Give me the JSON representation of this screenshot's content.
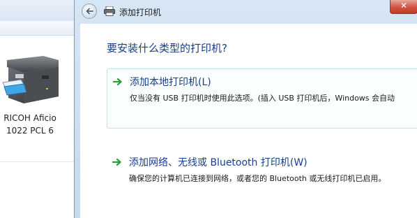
{
  "background_window": {
    "printer_name_line1": "RICOH Aficio",
    "printer_name_line2": "1022 PCL 6",
    "icons": {
      "printer": "printer-icon"
    }
  },
  "dialog": {
    "title": "添加打印机",
    "question": "要安装什么类型的打印机?",
    "icons": {
      "back": "back-arrow-icon",
      "title": "printer-icon",
      "option": "green-arrow-icon"
    },
    "options": [
      {
        "title": "添加本地打印机(L)",
        "description": "仅当没有 USB 打印机时使用此选项。(插入 USB 打印机后，Windows 会自动"
      },
      {
        "title": "添加网络、无线或 Bluetooth 打印机(W)",
        "description": "确保您的计算机已连接到网络，或者您的 Bluetooth 或无线打印机已启用。"
      }
    ]
  },
  "colors": {
    "titlebar": "#d7e6f5",
    "heading_blue": "#1a3e86",
    "option_border": "#bfe4f3",
    "arrow_green": "#2f9e3a",
    "close_red": "#d0533f"
  }
}
